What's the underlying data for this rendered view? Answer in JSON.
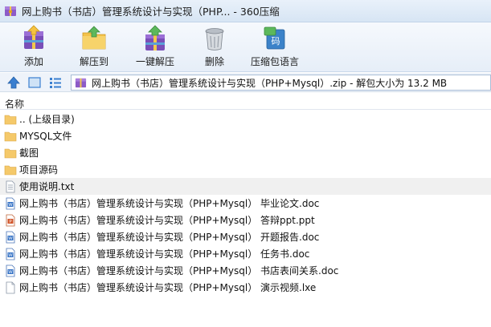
{
  "window": {
    "title": "网上购书（书店）管理系统设计与实现（PHP... - 360压缩"
  },
  "toolbar": {
    "items": [
      {
        "label": "添加",
        "icon": "add-archive-icon"
      },
      {
        "label": "解压到",
        "icon": "extract-to-icon"
      },
      {
        "label": "一键解压",
        "icon": "one-click-extract-icon"
      },
      {
        "label": "删除",
        "icon": "trash-icon"
      },
      {
        "label": "压缩包语言",
        "icon": "archive-language-icon"
      }
    ]
  },
  "address": {
    "path": "网上购书（书店）管理系统设计与实现（PHP+Mysql）.zip - 解包大小为 13.2 MB"
  },
  "list": {
    "header": {
      "name": "名称"
    },
    "items": [
      {
        "name": ".. (上级目录)",
        "type": "folder"
      },
      {
        "name": "MYSQL文件",
        "type": "folder"
      },
      {
        "name": "截图",
        "type": "folder"
      },
      {
        "name": "项目源码",
        "type": "folder"
      },
      {
        "name": "使用说明.txt",
        "type": "txt"
      },
      {
        "name": "网上购书（书店）管理系统设计与实现（PHP+Mysql） 毕业论文.doc",
        "type": "doc"
      },
      {
        "name": "网上购书（书店）管理系统设计与实现（PHP+Mysql） 答辩ppt.ppt",
        "type": "ppt"
      },
      {
        "name": "网上购书（书店）管理系统设计与实现（PHP+Mysql） 开题报告.doc",
        "type": "doc"
      },
      {
        "name": "网上购书（书店）管理系统设计与实现（PHP+Mysql） 任务书.doc",
        "type": "doc"
      },
      {
        "name": "网上购书（书店）管理系统设计与实现（PHP+Mysql） 书店表间关系.doc",
        "type": "doc"
      },
      {
        "name": "网上购书（书店）管理系统设计与实现（PHP+Mysql） 演示视频.lxe",
        "type": "file"
      }
    ]
  }
}
